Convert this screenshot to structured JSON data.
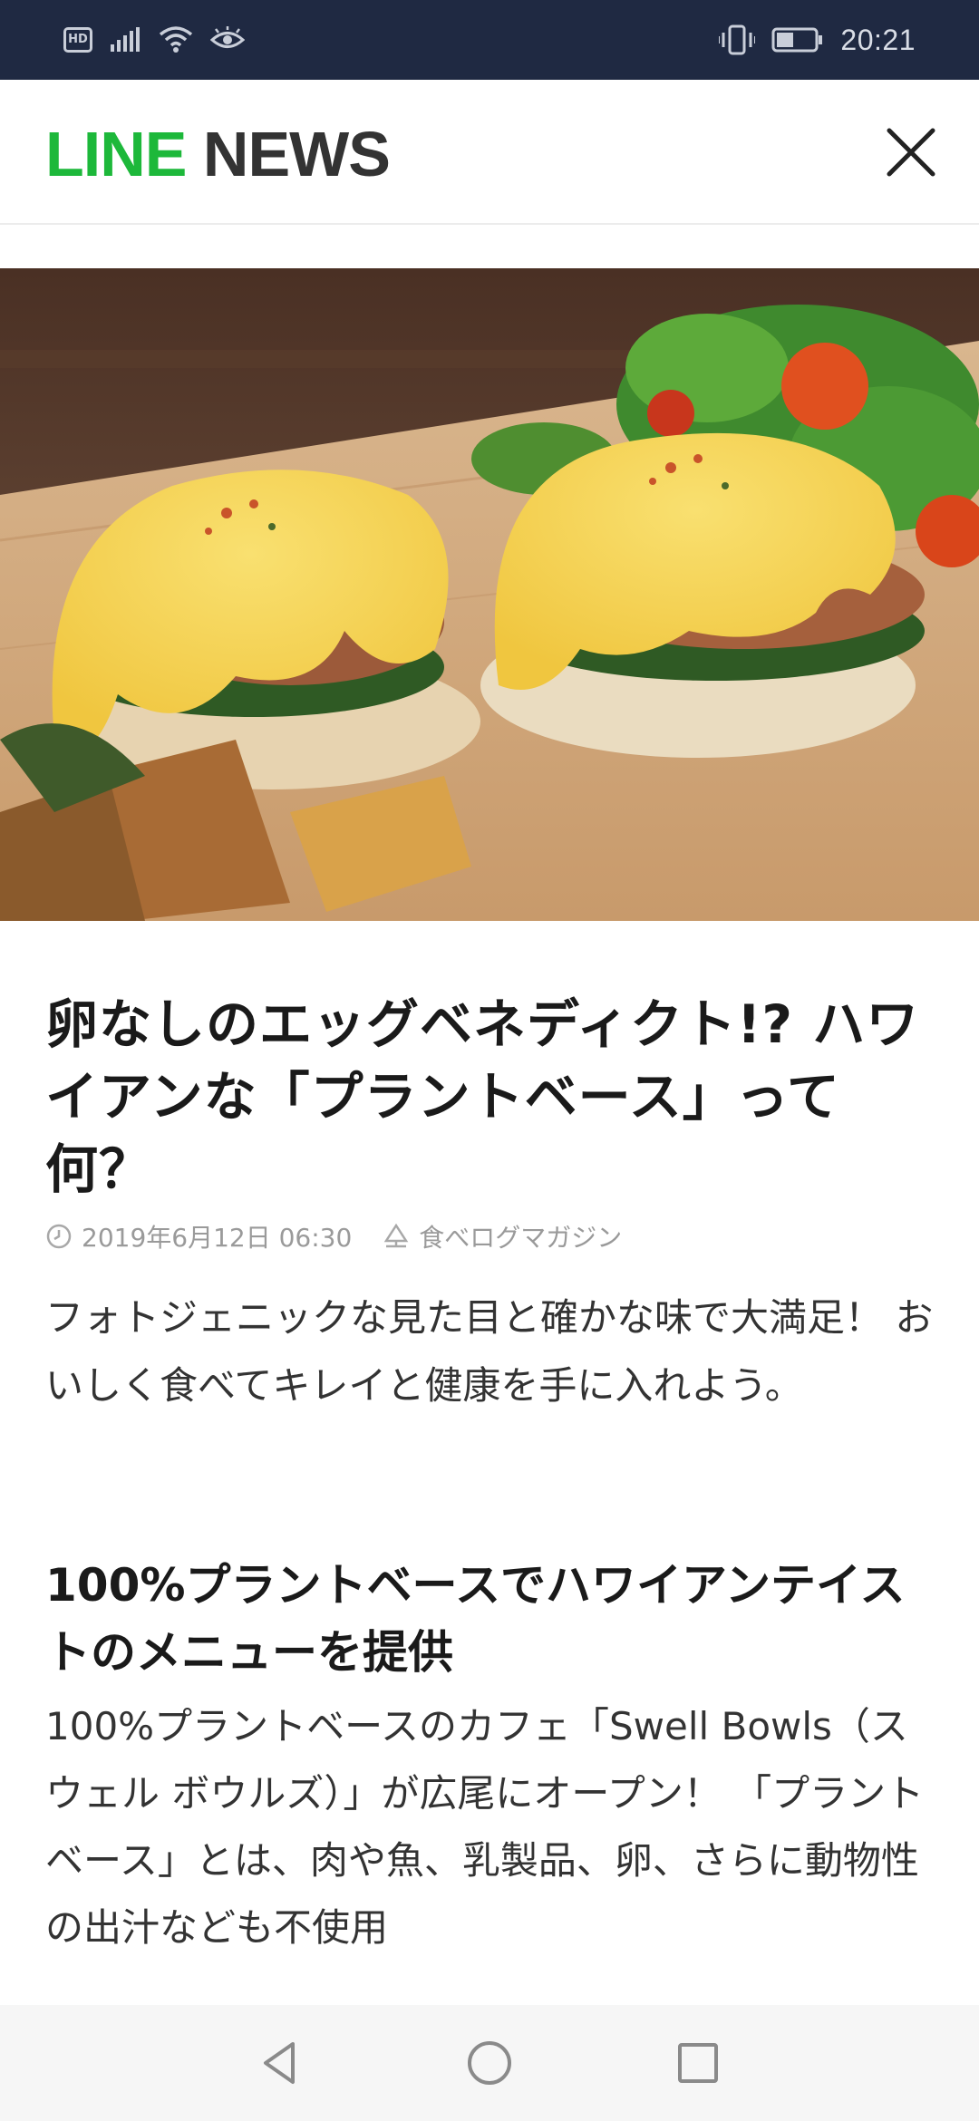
{
  "status_bar": {
    "hd_label": "HD",
    "time": "20:21",
    "icons": [
      "hd-icon",
      "signal-icon",
      "wifi-icon",
      "eye-icon",
      "vibrate-icon",
      "battery-icon"
    ]
  },
  "header": {
    "logo_part1": "LINE",
    "logo_part2": "NEWS",
    "close_icon": "close-icon"
  },
  "colors": {
    "status_bar_bg": "#1f2942",
    "logo_green": "#1db83a",
    "logo_dark": "#333333",
    "meta_gray": "#9a9a9a"
  },
  "article": {
    "hero_image": "eggs-benedict-photo",
    "title": "卵なしのエッグベネディクト!? ハワイアンな「プラントベース」って何？",
    "date": "2019年6月12日 06:30",
    "source": "食べログマガジン",
    "lead": "フォトジェニックな見た目と確かな味で大満足！ おいしく食べてキレイと健康を手に入れよう。",
    "section_heading": "100%プラントベースでハワイアンテイストのメニューを提供",
    "body": "100%プラントベースのカフェ「Swell Bowls（スウェル ボウルズ）」が広尾にオープン！ 「プラントベース」とは、肉や魚、乳製品、卵、さらに動物性の出汁なども不使用"
  },
  "nav": {
    "back_icon": "back-icon",
    "home_icon": "home-icon",
    "recents_icon": "recents-icon"
  }
}
